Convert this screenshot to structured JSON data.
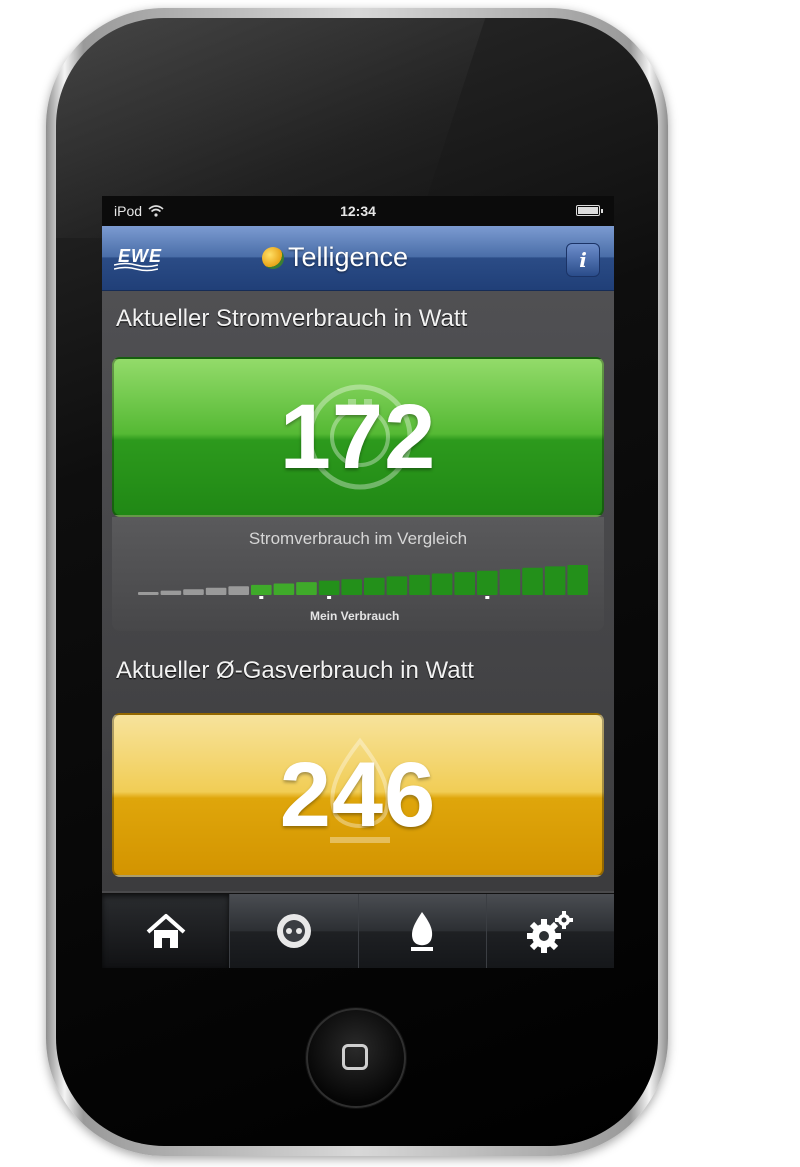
{
  "statusbar": {
    "carrier": "iPod",
    "time": "12:34"
  },
  "app": {
    "logo": "EWE",
    "brand": "Telligence",
    "info_label": "i"
  },
  "power": {
    "title": "Aktueller Stromverbrauch in Watt",
    "value": "172",
    "compare_title": "Stromverbrauch im Vergleich",
    "marker_label": "Mein Verbrauch",
    "level_count": 20,
    "active_from": 5,
    "accent": "#2d9a1d"
  },
  "gas": {
    "title": "Aktueller Ø-Gasverbrauch in Watt",
    "value": "246",
    "accent": "#dfa60b"
  },
  "tabs": [
    {
      "name": "home",
      "icon": "home-icon",
      "active": true
    },
    {
      "name": "power",
      "icon": "plug-icon",
      "active": false
    },
    {
      "name": "gas",
      "icon": "flame-icon",
      "active": false
    },
    {
      "name": "settings",
      "icon": "gear-icon",
      "active": false
    }
  ]
}
